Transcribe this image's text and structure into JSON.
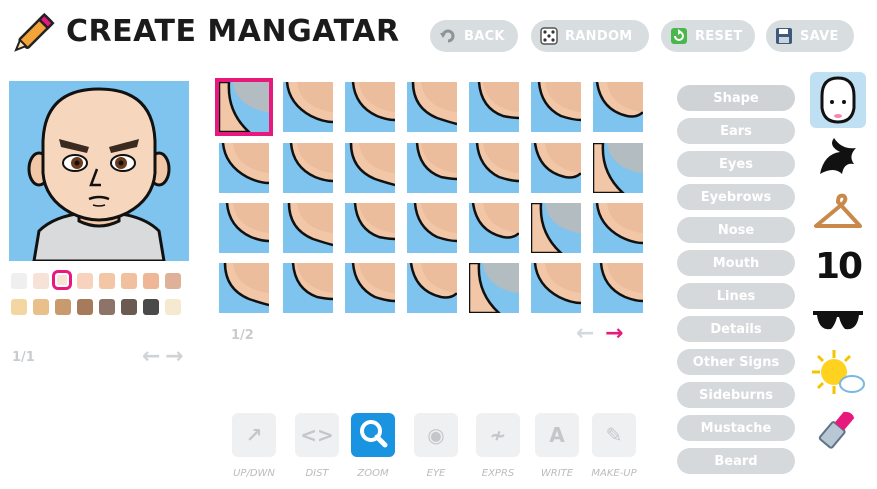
{
  "header": {
    "title": "CREATE MANGATAR",
    "buttons": [
      {
        "label": "BACK",
        "icon": "back-arrow-icon"
      },
      {
        "label": "RANDOM",
        "icon": "dice-icon"
      },
      {
        "label": "RESET",
        "icon": "reset-icon"
      },
      {
        "label": "SAVE",
        "icon": "floppy-disk-icon"
      }
    ]
  },
  "skin_swatches": [
    "#efefef",
    "#f6e2d6",
    "#f7e3d3",
    "#f7d2bd",
    "#f3c6a6",
    "#f1c09f",
    "#eeb896",
    "#deb198",
    "#f4d6a2",
    "#e9c08a",
    "#c89a6e",
    "#a67b5b",
    "#8e7468",
    "#6b5a52",
    "#4a4a4a",
    "#f5ead0"
  ],
  "avatar_pager": "1/1",
  "grid_pager": "1/2",
  "categories": [
    "Shape",
    "Ears",
    "Eyes",
    "Eyebrows",
    "Nose",
    "Mouth",
    "Lines",
    "Details",
    "Other Signs",
    "Sideburns",
    "Mustache",
    "Beard"
  ],
  "side_icons": [
    "face-shape-icon",
    "hair-icon",
    "clothes-hanger-icon",
    "number-ten-icon",
    "sunglasses-icon",
    "weather-sun-icon",
    "lipstick-icon"
  ],
  "tools": [
    {
      "label": "UP/DWN",
      "icon": "up-down-icon"
    },
    {
      "label": "DIST",
      "icon": "distance-icon"
    },
    {
      "label": "ZOOM",
      "icon": "zoom-icon"
    },
    {
      "label": "EYE",
      "icon": "eye-icon"
    },
    {
      "label": "EXPRS",
      "icon": "expression-icon"
    },
    {
      "label": "WRITE",
      "icon": "write-icon"
    },
    {
      "label": "MAKE-UP",
      "icon": "makeup-icon"
    }
  ],
  "colors": {
    "accent": "#e8197d",
    "sky": "#7ec4ef",
    "skin": "#f1c7a7",
    "active_tool": "#1a93e0"
  }
}
